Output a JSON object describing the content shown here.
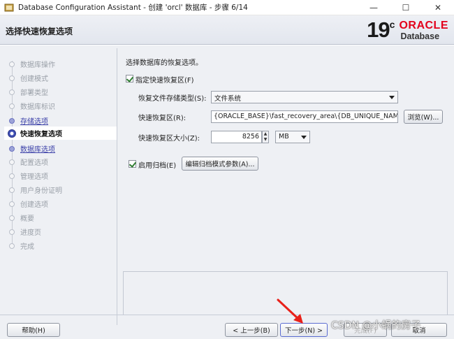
{
  "window": {
    "title": "Database Configuration Assistant - 创建 'orcl' 数据库 - 步骤 6/14",
    "minimize": "—",
    "maximize": "☐",
    "close": "✕"
  },
  "header": {
    "page_title": "选择快速恢复选项",
    "logo": {
      "version": "19",
      "suffix": "c",
      "brand": "ORACLE",
      "product": "Database",
      "brand_color": "#e3001b"
    }
  },
  "nav": {
    "items": [
      {
        "label": "数据库操作",
        "state": "disabled"
      },
      {
        "label": "创建模式",
        "state": "disabled"
      },
      {
        "label": "部署类型",
        "state": "disabled"
      },
      {
        "label": "数据库标识",
        "state": "disabled"
      },
      {
        "label": "存储选项",
        "state": "done"
      },
      {
        "label": "快速恢复选项",
        "state": "active"
      },
      {
        "label": "数据库选项",
        "state": "done"
      },
      {
        "label": "配置选项",
        "state": "disabled"
      },
      {
        "label": "管理选项",
        "state": "disabled"
      },
      {
        "label": "用户身份证明",
        "state": "disabled"
      },
      {
        "label": "创建选项",
        "state": "disabled"
      },
      {
        "label": "概要",
        "state": "disabled"
      },
      {
        "label": "进度页",
        "state": "disabled"
      },
      {
        "label": "完成",
        "state": "disabled"
      }
    ]
  },
  "content": {
    "intro": "选择数据库的恢复选项。",
    "specify_frа_checkbox": {
      "label": "指定快速恢复区(F)",
      "checked": true
    },
    "storage_type": {
      "label": "恢复文件存储类型(S):",
      "value": "文件系统"
    },
    "recovery_area": {
      "label": "快速恢复区(R):",
      "value": "{ORACLE_BASE}\\fast_recovery_area\\{DB_UNIQUE_NAME}",
      "browse": "浏览(W)..."
    },
    "recovery_size": {
      "label": "快速恢复区大小(Z):",
      "value": "8256",
      "unit": "MB"
    },
    "archive_checkbox": {
      "label": "启用归档(E)",
      "checked": true
    },
    "archive_params_button": "编辑归档模式参数(A)..."
  },
  "footer": {
    "help": "帮助(H)",
    "back": "< 上一步(B)",
    "next": "下一步(N) >",
    "finish": "完成(F)",
    "cancel": "取消"
  },
  "watermark": "CSDN @小蜗的房子",
  "annotation_color": "#e8211a"
}
